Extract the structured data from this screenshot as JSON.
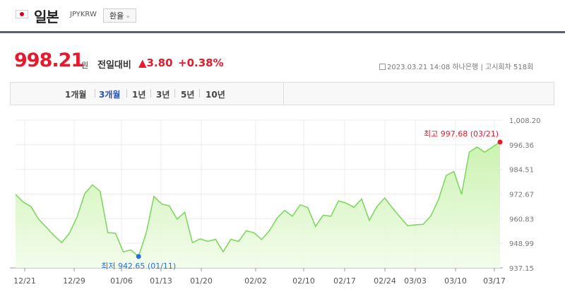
{
  "header": {
    "country": "일본",
    "code": "JPYKRW",
    "exchange_button": "환율",
    "exchange_button_arrow": "»"
  },
  "quote": {
    "price": "998.21",
    "unit": "원",
    "change_label": "전일대비",
    "change_arrow": "▲",
    "change": "3.80",
    "change_pct": "+0.38%",
    "datetime": "2023.03.21 14:08",
    "source": "하나은행",
    "notice": "고시회차 518회"
  },
  "colors": {
    "up": "#e8182d",
    "accent": "#2a52be",
    "line": "#79d65a",
    "fill": "#c8f2ad"
  },
  "periods": [
    {
      "label": "1개월",
      "active": false
    },
    {
      "label": "3개월",
      "active": true
    },
    {
      "label": "1년",
      "active": false
    },
    {
      "label": "3년",
      "active": false
    },
    {
      "label": "5년",
      "active": false
    },
    {
      "label": "10년",
      "active": false
    }
  ],
  "chart_data": {
    "type": "area",
    "x_ticks": [
      "12/21",
      "12/29",
      "01/06",
      "01/13",
      "01/20",
      "02/02",
      "02/10",
      "02/17",
      "02/24",
      "03/03",
      "03/10",
      "03/17"
    ],
    "y_ticks": [
      "1,008.20",
      "996.36",
      "984.51",
      "972.67",
      "960.83",
      "948.99",
      "937.15"
    ],
    "ylim": [
      937.15,
      1008.2
    ],
    "high": {
      "label": "최고 997.68 (03/21)",
      "value": 997.68,
      "date": "03/21"
    },
    "low": {
      "label": "최저 942.65 (01/11)",
      "value": 942.65,
      "date": "01/11"
    },
    "values": [
      972.5,
      968.8,
      966.7,
      960.6,
      956.7,
      952.7,
      949.3,
      953.8,
      961.6,
      972.9,
      977.1,
      974.0,
      954.1,
      953.8,
      944.9,
      945.8,
      942.65,
      954.1,
      971.5,
      967.9,
      967.0,
      960.6,
      963.9,
      949.3,
      951.1,
      949.9,
      950.9,
      944.9,
      950.9,
      949.9,
      955.0,
      954.1,
      950.8,
      955.0,
      961.1,
      964.8,
      962.0,
      967.5,
      966.2,
      957.1,
      962.5,
      962.0,
      969.4,
      968.3,
      966.3,
      970.3,
      960.0,
      966.7,
      970.8,
      966.0,
      961.6,
      957.4,
      957.9,
      958.1,
      962.1,
      970.0,
      981.6,
      983.5,
      972.5,
      992.8,
      995.3,
      992.8,
      995.3,
      997.68
    ],
    "grid": true
  }
}
